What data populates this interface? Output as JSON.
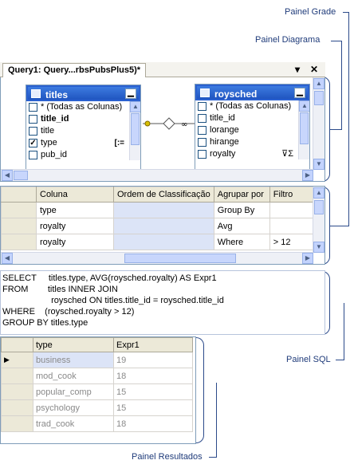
{
  "callouts": {
    "grid": "Painel Grade",
    "diagram": "Painel Diagrama",
    "sql": "Painel SQL",
    "results": "Painel Resultados"
  },
  "tab": {
    "title": "Query1: Query...rbsPubsPlus5)*",
    "dropdown": "▾",
    "close": "✕"
  },
  "diagram": {
    "titles": {
      "name": "titles",
      "rows": [
        {
          "label": "* (Todas as Colunas)",
          "checked": false,
          "bold": false
        },
        {
          "label": "title_id",
          "checked": false,
          "bold": true
        },
        {
          "label": "title",
          "checked": false,
          "bold": false
        },
        {
          "label": "type",
          "checked": true,
          "bold": false,
          "marker": "[:="
        },
        {
          "label": "pub_id",
          "checked": false,
          "bold": false
        }
      ]
    },
    "roysched": {
      "name": "roysched",
      "rows": [
        {
          "label": "* (Todas as Colunas)",
          "checked": false
        },
        {
          "label": "title_id",
          "checked": false
        },
        {
          "label": "lorange",
          "checked": false
        },
        {
          "label": "hirange",
          "checked": false
        },
        {
          "label": "royalty",
          "checked": false
        }
      ]
    }
  },
  "grid": {
    "headers": [
      "Coluna",
      "Ordem de Classificação",
      "Agrupar por",
      "Filtro"
    ],
    "rows": [
      [
        "type",
        "",
        "Group By",
        ""
      ],
      [
        "royalty",
        "",
        "Avg",
        ""
      ],
      [
        "royalty",
        "",
        "Where",
        "> 12"
      ]
    ]
  },
  "sql": {
    "text": "SELECT     titles.type, AVG(roysched.royalty) AS Expr1\nFROM        titles INNER JOIN\n                    roysched ON titles.title_id = roysched.title_id\nWHERE    (roysched.royalty > 12)\nGROUP BY titles.type"
  },
  "results": {
    "headers": [
      "type",
      "Expr1"
    ],
    "rows": [
      [
        "business",
        "19"
      ],
      [
        "mod_cook",
        "18"
      ],
      [
        "popular_comp",
        "15"
      ],
      [
        "psychology",
        "15"
      ],
      [
        "trad_cook",
        "18"
      ]
    ]
  },
  "colors": {
    "accent": "#2b61d0",
    "border": "#7f9db9",
    "callout_line": "#2b4a8a"
  }
}
